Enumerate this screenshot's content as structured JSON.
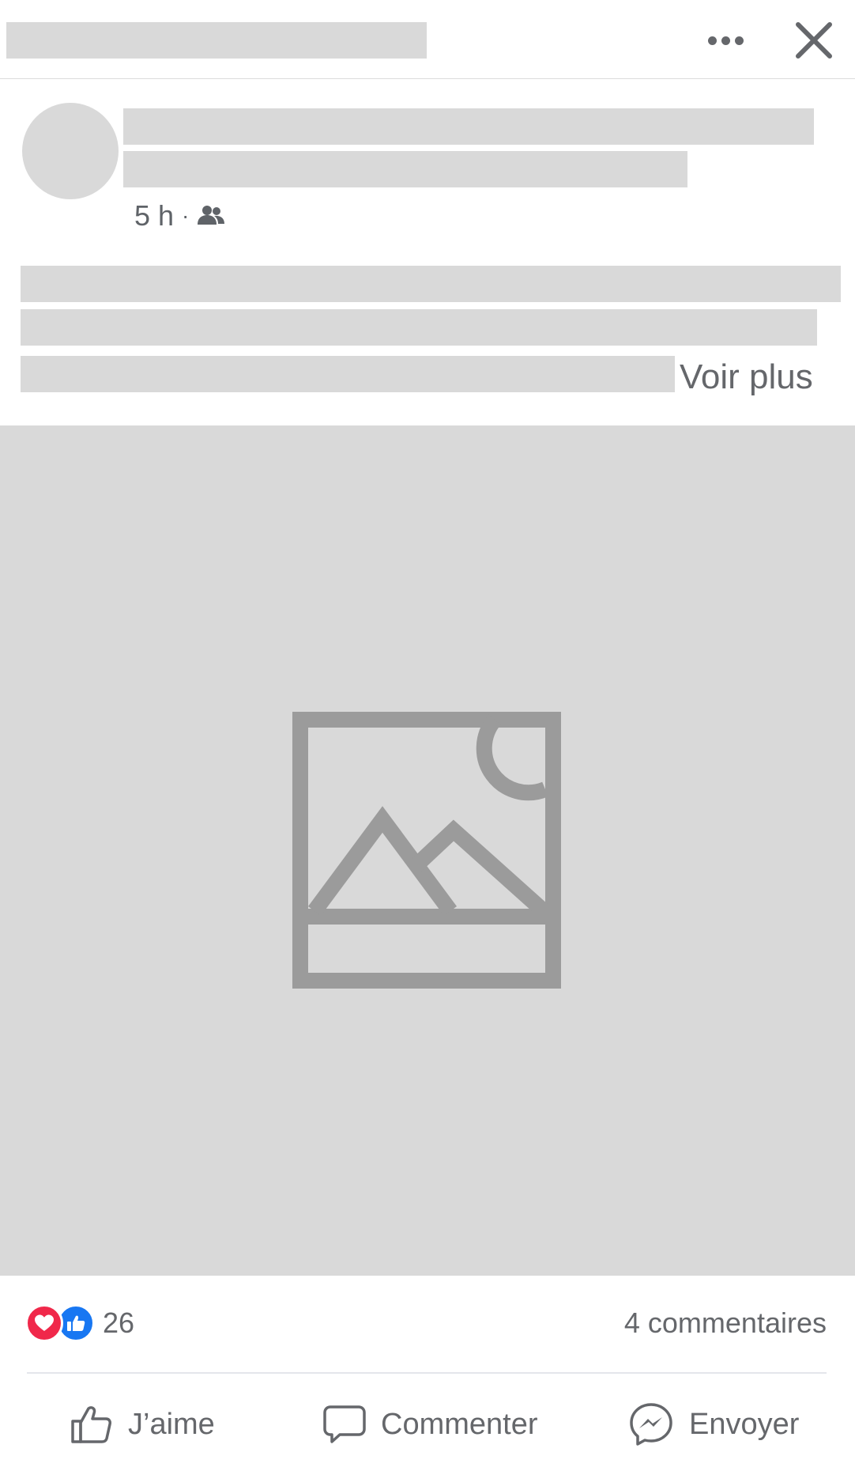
{
  "post": {
    "timestamp": "5 h",
    "separator": "·",
    "audience_icon": "friends-icon",
    "see_more": "Voir plus"
  },
  "header": {
    "more_icon": "more-horizontal-icon",
    "close_icon": "close-icon"
  },
  "photo": {
    "placeholder_icon": "image-placeholder-icon"
  },
  "stats": {
    "reactions": [
      "love",
      "like"
    ],
    "reaction_count": "26",
    "comments": "4 commentaires"
  },
  "actions": {
    "like": "J’aime",
    "comment": "Commenter",
    "send": "Envoyer"
  },
  "colors": {
    "placeholder": "#d9d9d9",
    "text": "#65676b",
    "love": "#f0284a",
    "like": "#1877f2"
  }
}
